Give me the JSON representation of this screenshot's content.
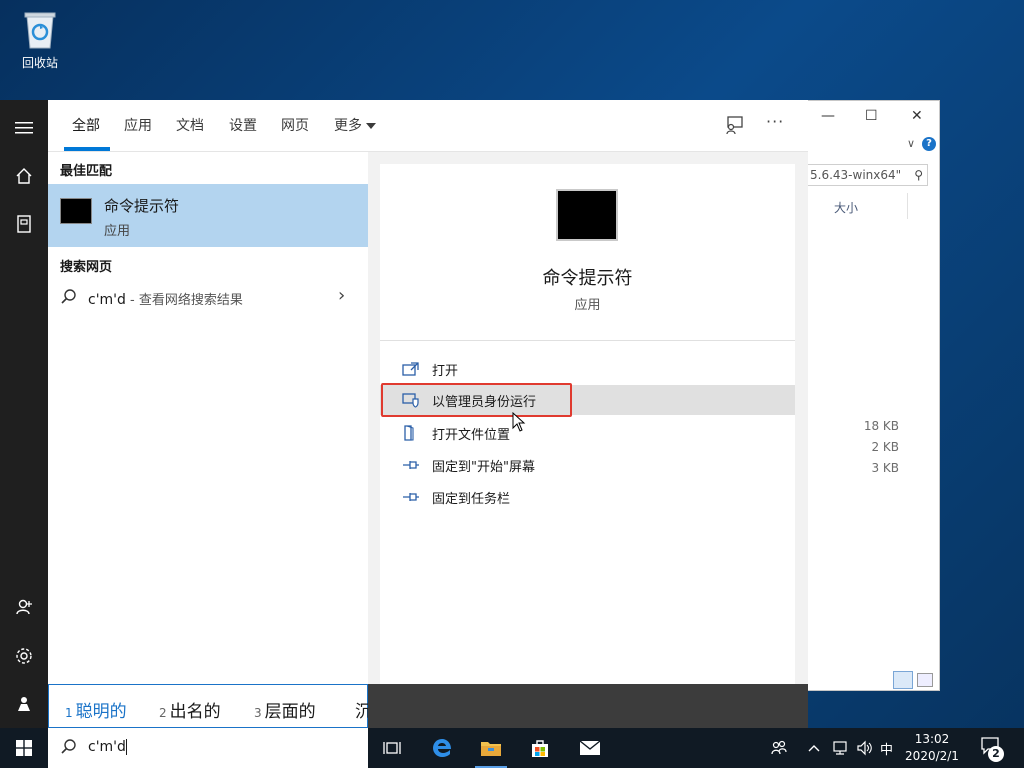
{
  "desktop": {
    "recycle_bin_label": "回收站"
  },
  "explorer": {
    "search_text": "5.6.43-winx64\"",
    "column_size": "大小",
    "help": "?",
    "sizes": [
      "18 KB",
      "2 KB",
      "3 KB"
    ]
  },
  "search": {
    "tabs": [
      {
        "label": "全部"
      },
      {
        "label": "应用"
      },
      {
        "label": "文档"
      },
      {
        "label": "设置"
      },
      {
        "label": "网页"
      },
      {
        "label": "更多"
      }
    ],
    "more_dots": "···",
    "best_match_heading": "最佳匹配",
    "best_match": {
      "name": "命令提示符",
      "type": "应用"
    },
    "web_heading": "搜索网页",
    "web_result": {
      "query": "c'm'd",
      "hint": " - 查看网络搜索结果"
    },
    "preview": {
      "title": "命令提示符",
      "subtitle": "应用"
    },
    "actions": [
      {
        "label": "打开",
        "icon": "open-icon"
      },
      {
        "label": "以管理员身份运行",
        "icon": "shield-icon"
      },
      {
        "label": "打开文件位置",
        "icon": "file-location-icon"
      },
      {
        "label": "固定到\"开始\"屏幕",
        "icon": "pin-icon"
      },
      {
        "label": "固定到任务栏",
        "icon": "pin-icon"
      }
    ]
  },
  "ime": {
    "candidates": [
      {
        "num": "1",
        "text": "聪明的"
      },
      {
        "num": "2",
        "text": "出名的"
      },
      {
        "num": "3",
        "text": "层面的"
      },
      {
        "num": "",
        "text": "沉"
      }
    ]
  },
  "taskbar": {
    "search_value": "c'm'd",
    "ime_mode": "中",
    "time": "13:02",
    "date": "2020/2/1",
    "notification_count": "2"
  },
  "colors": {
    "accent": "#0078d7",
    "selection": "#b3d4ef",
    "highlight_box": "#e03a2f",
    "taskbar": "#101a24"
  }
}
